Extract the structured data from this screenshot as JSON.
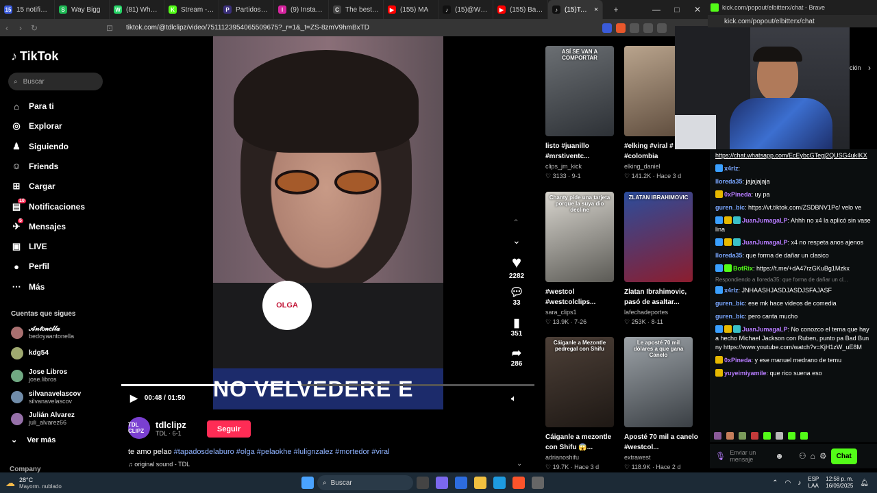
{
  "tabs": [
    {
      "label": "15 notificatio",
      "color": "#3b5bdb",
      "glyph": "15"
    },
    {
      "label": "Way Bigg",
      "color": "#1db954",
      "glyph": "S"
    },
    {
      "label": "(81) WhatsAp",
      "color": "#25d366",
      "glyph": "W"
    },
    {
      "label": "Stream - Kick",
      "color": "#53fc18",
      "glyph": "K"
    },
    {
      "label": "Partidos y res",
      "color": "#3a2f7a",
      "glyph": "P"
    },
    {
      "label": "(9) Instagram",
      "color": "#d6249f",
      "glyph": "I"
    },
    {
      "label": "The best Chat",
      "color": "#444444",
      "glyph": "C"
    },
    {
      "label": "(155) MA",
      "color": "#ff0000",
      "glyph": "▶"
    },
    {
      "label": "(15)@WestC",
      "color": "#111111",
      "glyph": "♪"
    },
    {
      "label": "(155) Bad Bu",
      "color": "#ff0000",
      "glyph": "▶"
    },
    {
      "label": "(15)Te A",
      "color": "#111111",
      "glyph": "♪"
    }
  ],
  "address": {
    "url": "tiktok.com/@tdlclipz/video/7511123954065509675?_r=1&_t=ZS-8zmV9hmBxTD"
  },
  "kick": {
    "window_title": "kick.com/popout/elbitterx/chat - Brave",
    "url": "kick.com/popout/elbitterx/chat",
    "pinned_link": "https://chat.whatsapp.com/EcEybcGTegj2QUSG4ukIKX",
    "messages": [
      {
        "user": "x4rlz",
        "color": "#7aa7ff",
        "text": "",
        "badges": [
          "#3aa0ff"
        ]
      },
      {
        "user": "lloreda35",
        "color": "#7aa7ff",
        "text": "jajajajaja",
        "badges": []
      },
      {
        "user": "0xPineda",
        "color": "#b77cff",
        "text": "uy pa",
        "badges": [
          "#e6b800"
        ]
      },
      {
        "user": "guren_bic",
        "color": "#7aa7ff",
        "text": "https://vt.tiktok.com/ZSDBNV1Pc/ velo ve",
        "badges": []
      },
      {
        "user": "JuanJumagaLP",
        "color": "#b77cff",
        "text": "Ahhh no x4 la aplicó sin vaselina",
        "badges": [
          "#3aa0ff",
          "#e6b800",
          "#39c0c8"
        ]
      },
      {
        "user": "JuanJumagaLP",
        "color": "#b77cff",
        "text": "x4 no respeta anos ajenos",
        "badges": [
          "#3aa0ff",
          "#e6b800",
          "#39c0c8"
        ]
      },
      {
        "user": "lloreda35",
        "color": "#7aa7ff",
        "text": "que forma de dañar un clasico",
        "badges": []
      },
      {
        "user": "BotRix",
        "color": "#53fc18",
        "text": "https://t.me/+dA47rzGKuBg1Mzkx",
        "badges": [
          "#3aa0ff",
          "#53fc18"
        ]
      },
      {
        "user": "x4rlz",
        "color": "#7aa7ff",
        "text": "JNHAASHJASDJASDJSFAJASF",
        "badges": [
          "#3aa0ff"
        ]
      },
      {
        "user": "guren_bic",
        "color": "#7aa7ff",
        "text": "ese mk hace videos de comedia",
        "badges": []
      },
      {
        "user": "guren_bic",
        "color": "#7aa7ff",
        "text": "pero canta mucho",
        "badges": []
      },
      {
        "user": "JuanJumagaLP",
        "color": "#b77cff",
        "text": "No conozco el tema que haya hecho Michael Jackson con Ruben, punto pa Bad Bunny https://www.youtube.com/watch?v=KjH1zW_uE8M",
        "badges": [
          "#3aa0ff",
          "#e6b800",
          "#39c0c8"
        ]
      },
      {
        "user": "0xPineda",
        "color": "#b77cff",
        "text": "y ese manuel medrano de temu",
        "badges": [
          "#e6b800"
        ]
      },
      {
        "user": "yuyeimiyamile",
        "color": "#b77cff",
        "text": "que rico suena eso",
        "badges": [
          "#e6b800"
        ]
      }
    ],
    "reply_hint": "Respondiendo a lloreda35: que forma de dañar un cl...",
    "input_placeholder": "Enviar un mensaje",
    "chat_button": "Chat",
    "side_label": "ción"
  },
  "tiktok": {
    "logo": "TikTok",
    "search_placeholder": "Buscar",
    "nav": [
      {
        "label": "Para ti",
        "icon": "⌂"
      },
      {
        "label": "Explorar",
        "icon": "◎"
      },
      {
        "label": "Siguiendo",
        "icon": "♟"
      },
      {
        "label": "Friends",
        "icon": "☺"
      },
      {
        "label": "Cargar",
        "icon": "⊞"
      },
      {
        "label": "Notificaciones",
        "icon": "▤",
        "badge": "10"
      },
      {
        "label": "Mensajes",
        "icon": "✈",
        "badge": "5"
      },
      {
        "label": "LIVE",
        "icon": "▣"
      },
      {
        "label": "Perfil",
        "icon": "●"
      },
      {
        "label": "Más",
        "icon": "⋯"
      }
    ],
    "following_header": "Cuentas que sigues",
    "following": [
      {
        "name": "𝒜𝓃𝓉𝑜𝓃𝑒𝓁𝓁𝒶",
        "handle": "bedoyaantonella"
      },
      {
        "name": "kdg54",
        "handle": ""
      },
      {
        "name": "Jose Libros",
        "handle": "jose.libros"
      },
      {
        "name": "silvanavelascov",
        "handle": "silvanavelascov"
      },
      {
        "name": "Julián Alvarez",
        "handle": "juli_alvarez66"
      }
    ],
    "see_more": "Ver más",
    "company": "Company",
    "video": {
      "time": "00:48 / 01:50",
      "progress": 0.436,
      "subtitle": "NO VELVEDERE E",
      "likes": "2282",
      "comments": "33",
      "saves": "351",
      "shares": "286"
    },
    "creator": {
      "name": "tdlclipz",
      "sub": "TDL · 6-1",
      "avatar_text": "TDL CLIPZ",
      "follow": "Seguir"
    },
    "caption_text": "te amo pelao",
    "caption_tags": "#tapadosdelaburo #olga #pelaokhe #lulignzalez #mortedor #viral",
    "sound": "♫ original sound - TDL",
    "recs": [
      {
        "title": "listo #juanillo #mrstiventc...",
        "user": "clips_jm_kick",
        "stats": "♡ 3133 · 9-1",
        "thumb_text": "ASÍ SE VAN A COMPORTAR",
        "c1": "#6b6f73",
        "c2": "#2d3136"
      },
      {
        "title": "#elking #viral # #colombia",
        "user": "elking_daniel",
        "stats": "♡ 141.2K · Hace 3 d",
        "thumb_text": "",
        "c1": "#b9a48d",
        "c2": "#5c4a3b"
      },
      {
        "title": "#westcol #westcolclips...",
        "user": "sara_clips1",
        "stats": "♡ 13.9K · 7-26",
        "thumb_text": "Chanty pide una tarjeta porque la suya dio decline",
        "c1": "#d9d6cf",
        "c2": "#5b5a55"
      },
      {
        "title": "Zlatan Ibrahimovic, pasó de asaltar...",
        "user": "lafechadeportes",
        "stats": "♡ 253K · 8-11",
        "thumb_text": "ZLATAN IBRAHIMOVIC",
        "c1": "#2b4d9c",
        "c2": "#8c1d2e"
      },
      {
        "title": "Cáiganle a mezontle con Shifu 😱...",
        "user": "adrianoshifu",
        "stats": "♡ 19.7K · Hace 3 d",
        "thumb_text": "Cáiganle a Mezontle pedregal con Shifu",
        "c1": "#4d4038",
        "c2": "#1e1814"
      },
      {
        "title": "Aposté 70 mil a canelo #westcol...",
        "user": "extrawest",
        "stats": "♡ 118.9K · Hace 2 d",
        "thumb_text": "Le aposté 70 mil dólares a que gana Canelo",
        "c1": "#9da3a8",
        "c2": "#3a3f44"
      }
    ]
  },
  "taskbar": {
    "weather_temp": "28°C",
    "weather_desc": "Mayorm. nublado",
    "search": "Buscar",
    "lang": "ESP",
    "lang2": "LAA",
    "time": "12:58 p. m.",
    "date": "16/09/2025"
  }
}
